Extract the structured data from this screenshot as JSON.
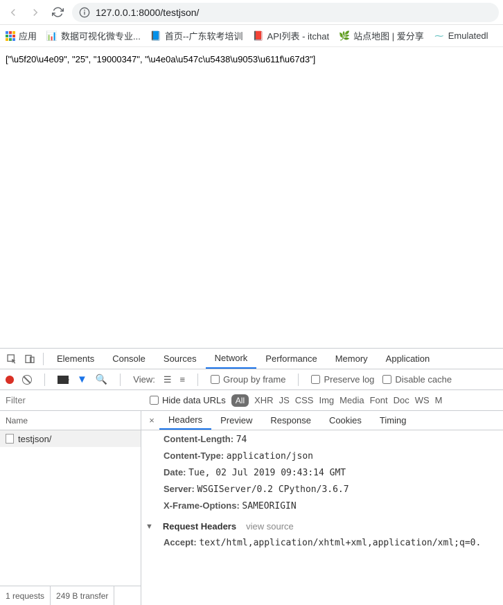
{
  "browser": {
    "url": "127.0.0.1:8000/testjson/"
  },
  "bookmarks": {
    "apps": "应用",
    "items": [
      {
        "icon": "📊",
        "label": "数据可视化微专业..."
      },
      {
        "icon": "📘",
        "label": "首页--广东软考培训"
      },
      {
        "icon": "📕",
        "label": "API列表 - itchat"
      },
      {
        "icon": "🌿",
        "label": "站点地图 | 爱分享"
      },
      {
        "icon": "⁓",
        "label": "Emulatedl"
      }
    ]
  },
  "page": {
    "body_text": "[\"\\u5f20\\u4e09\", \"25\", \"19000347\", \"\\u4e0a\\u547c\\u5438\\u9053\\u611f\\u67d3\"]"
  },
  "devtools": {
    "tabs": [
      "Elements",
      "Console",
      "Sources",
      "Network",
      "Performance",
      "Memory",
      "Application"
    ],
    "active_tab": "Network",
    "toolbar": {
      "view_label": "View:",
      "group": "Group by frame",
      "preserve": "Preserve log",
      "disable_cache": "Disable cache"
    },
    "filter": {
      "placeholder": "Filter",
      "hide_data": "Hide data URLs",
      "types": [
        "All",
        "XHR",
        "JS",
        "CSS",
        "Img",
        "Media",
        "Font",
        "Doc",
        "WS",
        "M"
      ]
    },
    "requests": {
      "name_col": "Name",
      "items": [
        {
          "name": "testjson/"
        }
      ],
      "summary_reqs": "1 requests",
      "summary_xfer": "249 B transfer"
    },
    "detail": {
      "tabs": [
        "Headers",
        "Preview",
        "Response",
        "Cookies",
        "Timing"
      ],
      "active": "Headers",
      "response_headers": [
        {
          "k": "Content-Length:",
          "v": "74"
        },
        {
          "k": "Content-Type:",
          "v": "application/json"
        },
        {
          "k": "Date:",
          "v": "Tue, 02 Jul 2019 09:43:14 GMT"
        },
        {
          "k": "Server:",
          "v": "WSGIServer/0.2 CPython/3.6.7"
        },
        {
          "k": "X-Frame-Options:",
          "v": "SAMEORIGIN"
        }
      ],
      "request_section": "Request Headers",
      "view_source": "view source",
      "request_headers": [
        {
          "k": "Accept:",
          "v": "text/html,application/xhtml+xml,application/xml;q=0."
        }
      ]
    }
  }
}
